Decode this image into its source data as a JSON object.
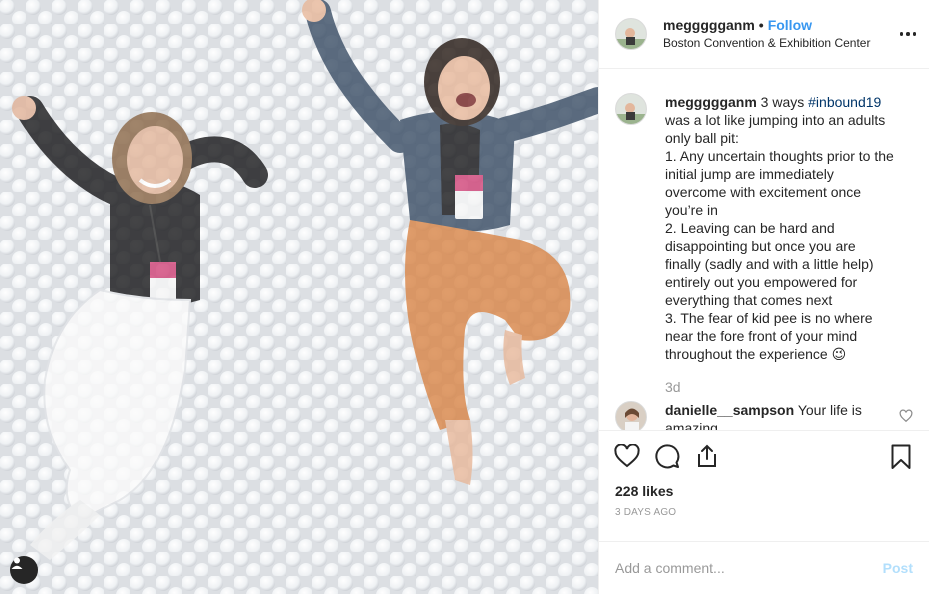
{
  "header": {
    "username": "meggggganm",
    "separator": "•",
    "follow_label": "Follow",
    "location": "Boston Convention & Exhibition Center",
    "more_icon": "more-options-icon"
  },
  "caption": {
    "username": "meggggganm",
    "lines": [
      "3 ways",
      "#inbound19",
      "was a lot like jumping into an adults",
      "only ball pit:",
      "1. Any uncertain thoughts prior to the",
      "initial jump are immediately",
      "overcome with excitement once",
      "you’re in",
      "2. Leaving can be hard and",
      "disappointing but once you are",
      "finally (sadly and with a little help)",
      "entirely out you empowered for",
      "everything that comes next",
      "3. The fear of kid pee is no where",
      "near the fore front of your mind",
      "throughout the experience 😉"
    ],
    "time_ago": "3d"
  },
  "comments": [
    {
      "username": "danielle__sampson",
      "text": "Your life is amazing"
    }
  ],
  "actions": {
    "like_icon": "heart-icon",
    "comment_icon": "comment-icon",
    "share_icon": "share-icon",
    "save_icon": "bookmark-icon"
  },
  "likes": "228 likes",
  "date": "3 DAYS AGO",
  "add_comment": {
    "placeholder": "Add a comment...",
    "post_label": "Post"
  },
  "colors": {
    "link_blue": "#3897f0",
    "hashtag": "#003569",
    "muted": "#999999",
    "post_disabled": "#b2dffc",
    "border": "#efefef"
  }
}
